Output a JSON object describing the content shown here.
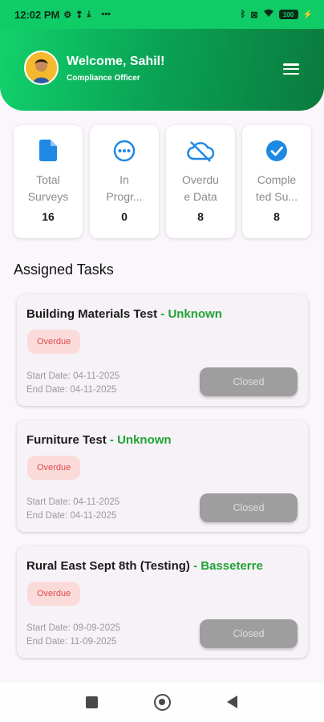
{
  "status_bar": {
    "time": "12:02 PM",
    "icons": [
      "gear-icon",
      "notification-icon",
      "download-icon",
      "more-icon"
    ],
    "right_icons": [
      "bluetooth-icon",
      "sim-icon",
      "wifi-icon"
    ],
    "battery": "100"
  },
  "header": {
    "welcome": "Welcome, Sahil!",
    "role": "Compliance Officer",
    "colors": {
      "start": "#12d26c",
      "end": "#0a7a3d"
    }
  },
  "stats": [
    {
      "icon": "document-icon",
      "label_lines": [
        "Total",
        "Surveys"
      ],
      "value": "16"
    },
    {
      "icon": "in-progress-icon",
      "label_lines": [
        "In",
        "Progr..."
      ],
      "value": "0"
    },
    {
      "icon": "cloud-off-icon",
      "label_lines": [
        "Overdu",
        "e Data"
      ],
      "value": "8"
    },
    {
      "icon": "check-circle-icon",
      "label_lines": [
        "Comple",
        "ted Su..."
      ],
      "value": "8"
    }
  ],
  "section_title": "Assigned Tasks",
  "tasks": [
    {
      "title": "Building Materials Test",
      "separator": " - ",
      "location": "Unknown",
      "status": "Overdue",
      "start": "Start Date: 04-11-2025",
      "end": "End Date: 04-11-2025",
      "action": "Closed"
    },
    {
      "title": "Furniture Test",
      "separator": " - ",
      "location": "Unknown",
      "status": "Overdue",
      "start": "Start Date: 04-11-2025",
      "end": "End Date: 04-11-2025",
      "action": "Closed"
    },
    {
      "title": "Rural East Sept 8th (Testing)",
      "separator": " - ",
      "location": "Basseterre",
      "status": "Overdue",
      "start": "Start Date: 09-09-2025",
      "end": "End Date: 11-09-2025",
      "action": "Closed"
    }
  ],
  "colors": {
    "accent": "#1e88e5",
    "location": "#21a334",
    "overdue_bg": "#fbdada",
    "overdue_text": "#e04a4a"
  }
}
